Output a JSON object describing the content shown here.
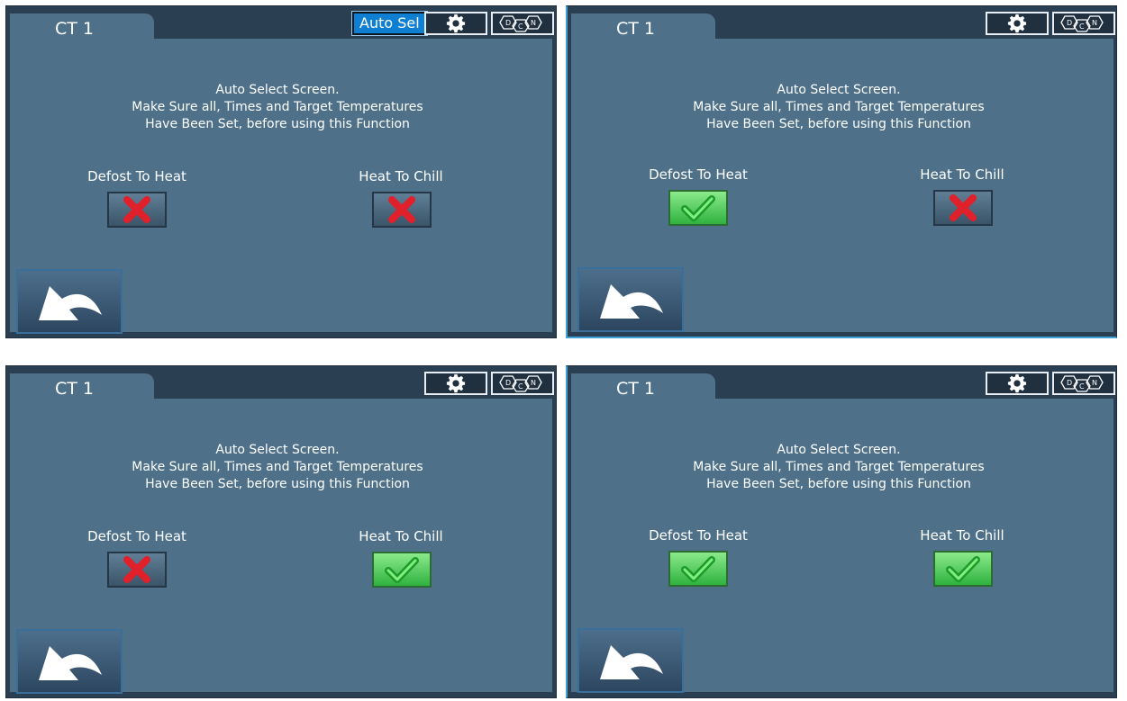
{
  "colors": {
    "panel_frame": "#2a3f52",
    "content_bg": "#4e7189",
    "accent": "#0e7fd3",
    "off_toggle": "#4d6a80",
    "on_toggle": "#3ccf4c",
    "x_mark": "#e0202a"
  },
  "panels": [
    {
      "tab_label": "CT 1",
      "auto_sel_label": "Auto Sel",
      "gear_icon": "gear-icon",
      "logo_icon": "dcn-logo-icon",
      "message": [
        "Auto Select Screen.",
        "Make Sure all, Times and Target Temperatures",
        "Have Been Set, before using this Function"
      ],
      "option_a": {
        "label": "Defost To Heat",
        "state": "off",
        "icon": "x-icon"
      },
      "option_b": {
        "label": "Heat To Chill",
        "state": "off",
        "icon": "x-icon"
      },
      "back_icon": "back-arrow-icon"
    },
    {
      "tab_label": "CT 1",
      "message": [
        "Auto Select Screen.",
        "Make Sure all, Times and Target Temperatures",
        "Have Been Set, before using this Function"
      ],
      "option_a": {
        "label": "Defost To Heat",
        "state": "on",
        "icon": "check-icon"
      },
      "option_b": {
        "label": "Heat To Chill",
        "state": "off",
        "icon": "x-icon"
      }
    },
    {
      "tab_label": "CT 1",
      "message": [
        "Auto Select Screen.",
        "Make Sure all, Times and Target Temperatures",
        "Have Been Set, before using this Function"
      ],
      "option_a": {
        "label": "Defost To Heat",
        "state": "off",
        "icon": "x-icon"
      },
      "option_b": {
        "label": "Heat To Chill",
        "state": "on",
        "icon": "check-icon"
      }
    },
    {
      "tab_label": "CT 1",
      "message": [
        "Auto Select Screen.",
        "Make Sure all, Times and Target Temperatures",
        "Have Been Set, before using this Function"
      ],
      "option_a": {
        "label": "Defost To Heat",
        "state": "on",
        "icon": "check-icon"
      },
      "option_b": {
        "label": "Heat To Chill",
        "state": "on",
        "icon": "check-icon"
      }
    }
  ]
}
